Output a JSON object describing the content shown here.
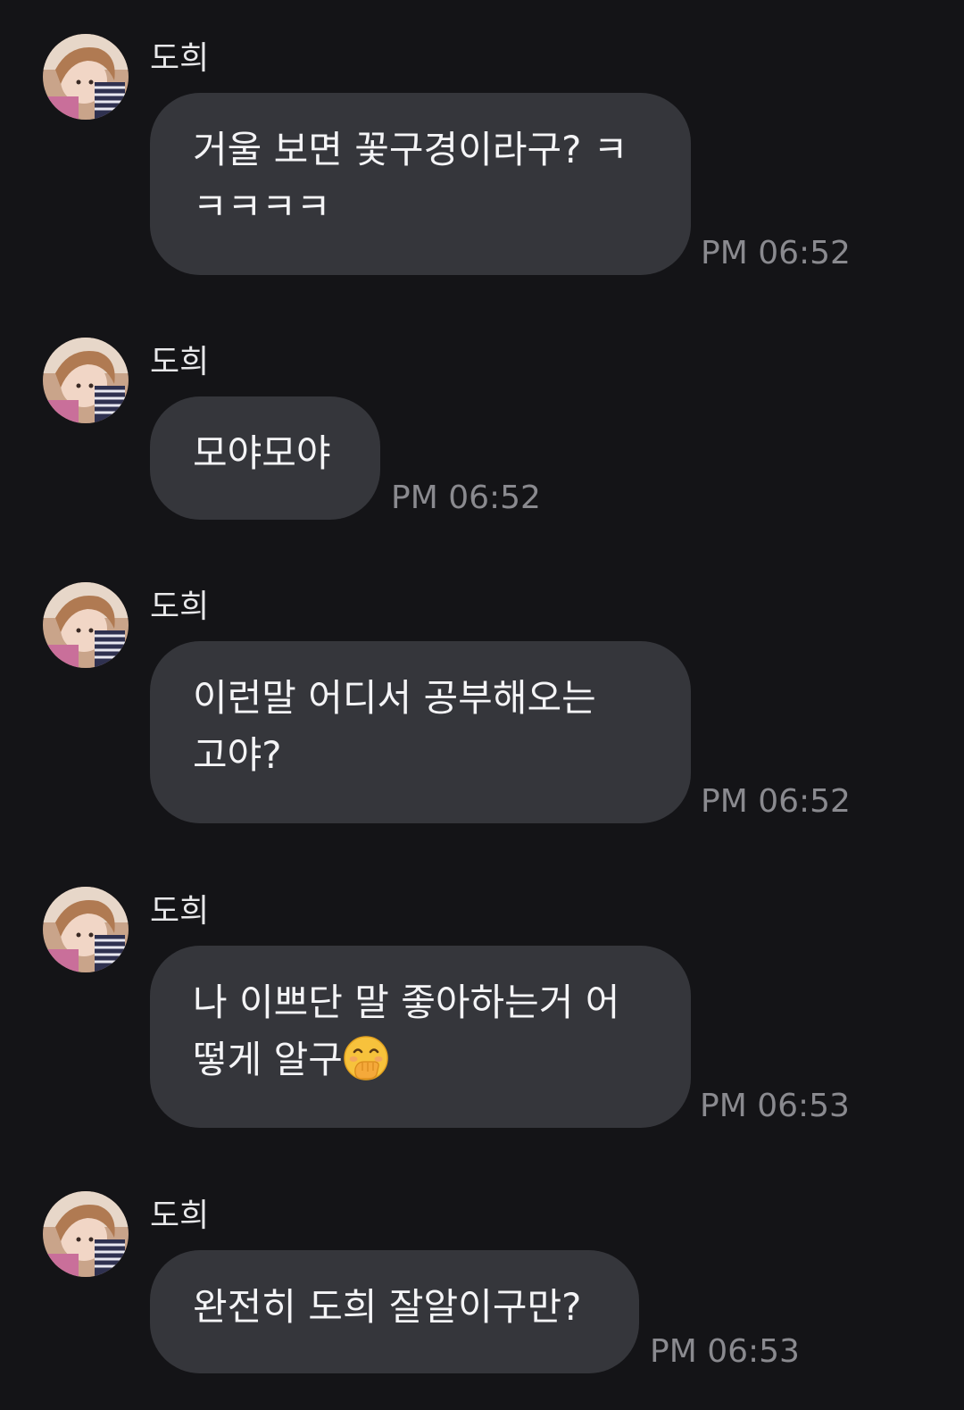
{
  "sender_name": "도희",
  "messages": [
    {
      "text": "거울 보면 꽃구경이라구? ㅋ\nㅋㅋㅋㅋ",
      "time": "PM 06:52"
    },
    {
      "text": "모야모야",
      "time": "PM 06:52"
    },
    {
      "text": "이런말 어디서 공부해오는\n고야?",
      "time": "PM 06:52"
    },
    {
      "text": "나 이쁘단 말 좋아하는거 어\n떻게 알구",
      "emoji": "face-with-hand-over-mouth-icon",
      "time": "PM 06:53"
    },
    {
      "text": "완전히 도희 잘알이구만?",
      "time": "PM 06:53"
    }
  ],
  "colors": {
    "background": "#141417",
    "bubble": "#35363b",
    "timestamp": "#8a8a8f"
  }
}
